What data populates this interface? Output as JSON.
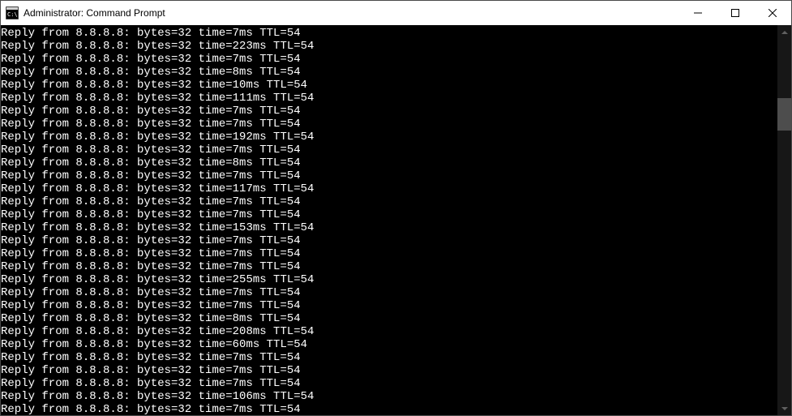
{
  "window": {
    "title": "Administrator: Command Prompt"
  },
  "ping": {
    "host": "8.8.8.8",
    "bytes": 32,
    "ttl": 54,
    "replies": [
      {
        "time_ms": 7
      },
      {
        "time_ms": 223
      },
      {
        "time_ms": 7
      },
      {
        "time_ms": 8
      },
      {
        "time_ms": 10
      },
      {
        "time_ms": 111
      },
      {
        "time_ms": 7
      },
      {
        "time_ms": 7
      },
      {
        "time_ms": 192
      },
      {
        "time_ms": 7
      },
      {
        "time_ms": 8
      },
      {
        "time_ms": 7
      },
      {
        "time_ms": 117
      },
      {
        "time_ms": 7
      },
      {
        "time_ms": 7
      },
      {
        "time_ms": 153
      },
      {
        "time_ms": 7
      },
      {
        "time_ms": 7
      },
      {
        "time_ms": 7
      },
      {
        "time_ms": 255
      },
      {
        "time_ms": 7
      },
      {
        "time_ms": 7
      },
      {
        "time_ms": 8
      },
      {
        "time_ms": 208
      },
      {
        "time_ms": 60
      },
      {
        "time_ms": 7
      },
      {
        "time_ms": 7
      },
      {
        "time_ms": 7
      },
      {
        "time_ms": 106
      },
      {
        "time_ms": 7
      }
    ]
  }
}
